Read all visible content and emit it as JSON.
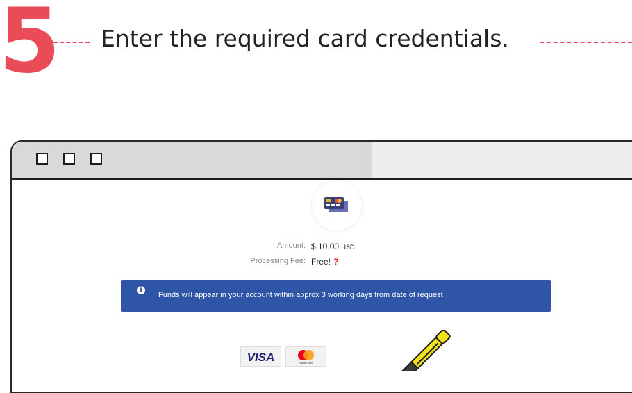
{
  "step": {
    "number": "5",
    "instruction": "Enter the required card credentials."
  },
  "browser": {
    "window_buttons": [
      "square",
      "square",
      "square"
    ]
  },
  "payment": {
    "card_icon": "credit-card-icon",
    "amount_label": "Amount:",
    "amount_value": "$ 10.00",
    "amount_currency": "USD",
    "fee_label": "Processing Fee:",
    "fee_value": "Free!",
    "fee_help": "?",
    "notice_icon": "info-icon",
    "notice_text": "Funds will appear in your account within approx 3 working days from date of request",
    "card_brands": {
      "visa": "VISA",
      "mastercard": "mastercard"
    }
  },
  "colors": {
    "accent_red": "#e94b57",
    "notice_blue": "#2f56a6",
    "help_red": "#e02020",
    "pen_yellow": "#f2e21a"
  }
}
